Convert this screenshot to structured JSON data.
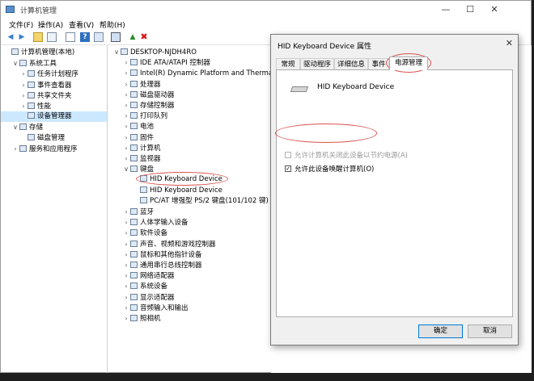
{
  "app": {
    "title": "计算机管理"
  },
  "menu": [
    "文件(F)",
    "操作(A)",
    "查看(V)",
    "帮助(H)"
  ],
  "toolbar_icons": [
    "back-icon",
    "forward-icon",
    "up-folder-icon",
    "console-tree-icon",
    "properties-icon",
    "help-icon",
    "show-hide-icon",
    "monitor-icon",
    "update-driver-icon",
    "uninstall-icon"
  ],
  "left_tree": [
    {
      "label": "计算机管理(本地)",
      "depth": 0,
      "arrow": "",
      "icon": "computer-mgmt-icon"
    },
    {
      "label": "系统工具",
      "depth": 1,
      "arrow": "v",
      "icon": "tools-icon"
    },
    {
      "label": "任务计划程序",
      "depth": 2,
      "arrow": ">",
      "icon": "clock-icon"
    },
    {
      "label": "事件查看器",
      "depth": 2,
      "arrow": ">",
      "icon": "event-viewer-icon"
    },
    {
      "label": "共享文件夹",
      "depth": 2,
      "arrow": ">",
      "icon": "shared-folder-icon"
    },
    {
      "label": "性能",
      "depth": 2,
      "arrow": ">",
      "icon": "performance-icon"
    },
    {
      "label": "设备管理器",
      "depth": 2,
      "arrow": "",
      "icon": "device-manager-icon",
      "selected": true
    },
    {
      "label": "存储",
      "depth": 1,
      "arrow": "v",
      "icon": "storage-icon"
    },
    {
      "label": "磁盘管理",
      "depth": 2,
      "arrow": "",
      "icon": "disk-icon"
    },
    {
      "label": "服务和应用程序",
      "depth": 1,
      "arrow": ">",
      "icon": "services-icon"
    }
  ],
  "device_tree": [
    {
      "label": "DESKTOP-NJDH4RO",
      "depth": 0,
      "arrow": "v",
      "icon": "computer-icon"
    },
    {
      "label": "IDE ATA/ATAPI 控制器",
      "depth": 1,
      "arrow": ">",
      "icon": "ide-icon"
    },
    {
      "label": "Intel(R) Dynamic Platform and Thermal Framework",
      "depth": 1,
      "arrow": ">",
      "icon": "chip-icon"
    },
    {
      "label": "处理器",
      "depth": 1,
      "arrow": ">",
      "icon": "processor-icon"
    },
    {
      "label": "磁盘驱动器",
      "depth": 1,
      "arrow": ">",
      "icon": "disk-drive-icon"
    },
    {
      "label": "存储控制器",
      "depth": 1,
      "arrow": ">",
      "icon": "storage-controller-icon"
    },
    {
      "label": "打印队列",
      "depth": 1,
      "arrow": ">",
      "icon": "printer-icon"
    },
    {
      "label": "电池",
      "depth": 1,
      "arrow": ">",
      "icon": "battery-icon"
    },
    {
      "label": "固件",
      "depth": 1,
      "arrow": ">",
      "icon": "firmware-icon"
    },
    {
      "label": "计算机",
      "depth": 1,
      "arrow": ">",
      "icon": "computer-icon"
    },
    {
      "label": "监视器",
      "depth": 1,
      "arrow": ">",
      "icon": "monitor-icon"
    },
    {
      "label": "键盘",
      "depth": 1,
      "arrow": "v",
      "icon": "keyboard-icon"
    },
    {
      "label": "HID Keyboard Device",
      "depth": 2,
      "arrow": "",
      "icon": "keyboard-icon"
    },
    {
      "label": "HID Keyboard Device",
      "depth": 2,
      "arrow": "",
      "icon": "keyboard-icon"
    },
    {
      "label": "PC/AT 增强型 PS/2 键盘(101/102 键)",
      "depth": 2,
      "arrow": "",
      "icon": "keyboard-icon"
    },
    {
      "label": "蓝牙",
      "depth": 1,
      "arrow": ">",
      "icon": "bluetooth-icon"
    },
    {
      "label": "人体学输入设备",
      "depth": 1,
      "arrow": ">",
      "icon": "hid-icon"
    },
    {
      "label": "软件设备",
      "depth": 1,
      "arrow": ">",
      "icon": "software-device-icon"
    },
    {
      "label": "声音、视频和游戏控制器",
      "depth": 1,
      "arrow": ">",
      "icon": "sound-icon"
    },
    {
      "label": "鼠标和其他指针设备",
      "depth": 1,
      "arrow": ">",
      "icon": "mouse-icon"
    },
    {
      "label": "通用串行总线控制器",
      "depth": 1,
      "arrow": ">",
      "icon": "usb-icon"
    },
    {
      "label": "网络适配器",
      "depth": 1,
      "arrow": ">",
      "icon": "network-icon"
    },
    {
      "label": "系统设备",
      "depth": 1,
      "arrow": ">",
      "icon": "system-device-icon"
    },
    {
      "label": "显示适配器",
      "depth": 1,
      "arrow": ">",
      "icon": "display-adapter-icon"
    },
    {
      "label": "音频输入和输出",
      "depth": 1,
      "arrow": ">",
      "icon": "audio-icon"
    },
    {
      "label": "照相机",
      "depth": 1,
      "arrow": ">",
      "icon": "camera-icon"
    }
  ],
  "dialog": {
    "title": "HID Keyboard Device 属性",
    "tabs": [
      "常规",
      "驱动程序",
      "详细信息",
      "事件",
      "电源管理"
    ],
    "active_tab": 4,
    "device_name": "HID Keyboard Device",
    "option_power_off": "允许计算机关闭此设备以节约电源(A)",
    "option_wake": "允许此设备唤醒计算机(O)",
    "option_power_off_checked": false,
    "option_power_off_enabled": false,
    "option_wake_checked": true,
    "ok": "确定",
    "cancel": "取消"
  },
  "colors": {
    "selection": "#cce8ff",
    "annotation": "#d9534f",
    "accent": "#0078d7"
  }
}
